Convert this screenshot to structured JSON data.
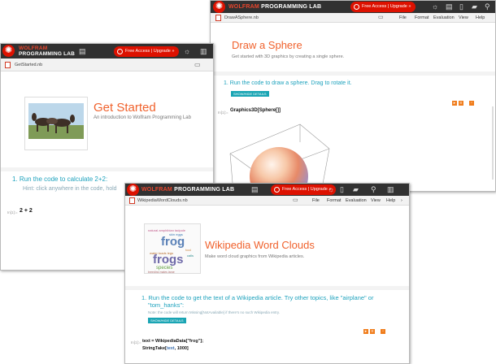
{
  "brand": {
    "wolfram": "WOLFRAM",
    "product": "PROGRAMMING LAB"
  },
  "upgrade_label": "Free Access | Upgrade »",
  "menu": [
    "File",
    "Format",
    "Evaluation",
    "View",
    "Help"
  ],
  "sphere": {
    "filename": "DrawASphere.nb",
    "title": "Draw a Sphere",
    "subtitle": "Get started with 3D graphics by creating a single sphere.",
    "step": "1. Run the code to draw a sphere. Drag to rotate it.",
    "showhide": "SHOW/HIDE DETAILS",
    "in_label": "In[1]:=",
    "code_fn": "Graphics3D",
    "code_arg": "Sphere"
  },
  "started": {
    "filename": "GetStarted.nb",
    "title": "Get Started",
    "subtitle": "An introduction to Wolfram Programming Lab",
    "step": "1. Run the code to calculate 2+2:",
    "hint": "Hint: click anywhere in the code, hold",
    "in_label": "In[1]:=",
    "code": "2 + 2"
  },
  "wiki": {
    "filename": "WikipediaWordClouds.nb",
    "title": "Wikipedia Word Clouds",
    "subtitle": "Make word cloud graphics from Wikipedia articles.",
    "step_line1": "1. Run the code to get the text of a Wikipedia article. Try other topics, like \"airplane\" or",
    "step_line2": "\"tom_hanks\":",
    "note": "Note: the code will return Missing[NotAvailable] if there's no such Wikipedia entry.",
    "showhide": "SHOW/HIDE DETAILS",
    "in_label": "In[1]:=",
    "code_line1_a": "text = WikipediaData[",
    "code_line1_str": "\"frog\"",
    "code_line1_b": "];",
    "code_line2_a": "StringTake[",
    "code_line2_var": "text",
    "code_line2_b": ", 1000]",
    "cloud_words": [
      "frog",
      "frogs",
      "species"
    ]
  }
}
